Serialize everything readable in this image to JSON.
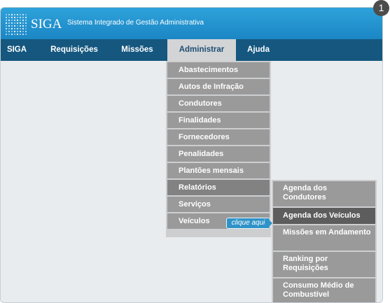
{
  "step_badge": "1",
  "header": {
    "logo_text": "SIGA",
    "app_title": "Sistema Integrado de Gestão Administrativa"
  },
  "nav": {
    "items": [
      {
        "label": "SIGA"
      },
      {
        "label": "Requisições"
      },
      {
        "label": "Missões"
      },
      {
        "label": "Administrar"
      },
      {
        "label": "Ajuda"
      }
    ]
  },
  "submenu": {
    "items": [
      {
        "label": "Abastecimentos"
      },
      {
        "label": "Autos de Infração"
      },
      {
        "label": "Condutores"
      },
      {
        "label": "Finalidades"
      },
      {
        "label": "Fornecedores"
      },
      {
        "label": "Penalidades"
      },
      {
        "label": "Plantões mensais"
      },
      {
        "label": "Relatórios"
      },
      {
        "label": "Serviços"
      },
      {
        "label": "Veículos"
      }
    ]
  },
  "reports_submenu": {
    "items": [
      {
        "label": "Agenda dos Condutores"
      },
      {
        "label": "Agenda dos Veículos"
      },
      {
        "label": "Missões em Andamento"
      },
      {
        "label": "Ranking por Requisições"
      },
      {
        "label": "Consumo Médio de Combustível"
      }
    ]
  },
  "callout": {
    "text": "clique aqui"
  },
  "colors": {
    "header": "#1b86c4",
    "navbar": "#15577f",
    "menu_item": "#9a9a9a",
    "menu_active": "#5d5d5d",
    "callout": "#2f93c8"
  }
}
